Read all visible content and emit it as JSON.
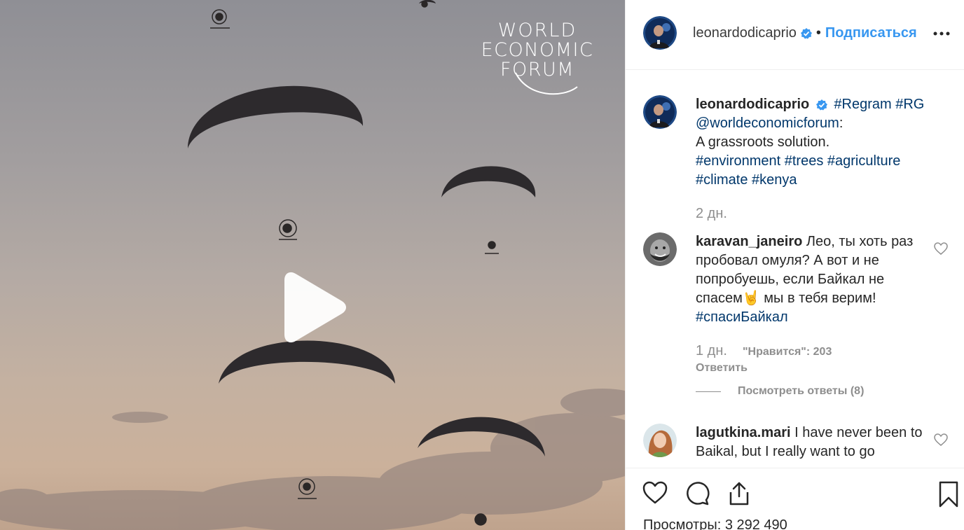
{
  "video": {
    "overlay_logo": {
      "line1": "WORLD",
      "line2": "ECONOMIC",
      "line3": "FORUM"
    },
    "play_icon": "play-icon"
  },
  "header": {
    "username": "leonardodicaprio",
    "separator": "•",
    "follow_label": "Подписаться",
    "verified_icon": "verified-badge-icon",
    "more_icon": "more-options-icon"
  },
  "caption": {
    "username": "leonardodicaprio",
    "tag1": "#Regram",
    "tag2": "#RG",
    "mention": "@worldeconomicforum",
    "mention_suffix": ":",
    "text": "A grassroots solution.",
    "tag3": "#environment",
    "tag4": "#trees",
    "tag5": "#agriculture",
    "tag6": "#climate",
    "tag7": "#kenya",
    "time": "2 дн."
  },
  "comments": [
    {
      "username": "karavan_janeiro",
      "text_part1": "Лео, ты хоть раз пробовал омуля? А вот и не попробуешь, если Байкал не спасем",
      "emoji": "🤘",
      "text_part2": " мы в тебя верим!",
      "tag": "#спасиБайкал",
      "time": "1 дн.",
      "likes": "\"Нравится\": 203",
      "reply_label": "Ответить",
      "view_replies": "Посмотреть ответы (8)"
    },
    {
      "username": "lagutkina.mari",
      "text": "I have never been to Baikal, but I really want to go"
    }
  ],
  "actions": {
    "like_icon": "heart-icon",
    "comment_icon": "comment-icon",
    "share_icon": "share-icon",
    "save_icon": "bookmark-icon",
    "views_label": "Просмотры: 3 292 490"
  },
  "colors": {
    "link_blue": "#3897f0",
    "hashtag": "#00376b",
    "muted": "#8e8e8e",
    "verified": "#3897f0"
  }
}
